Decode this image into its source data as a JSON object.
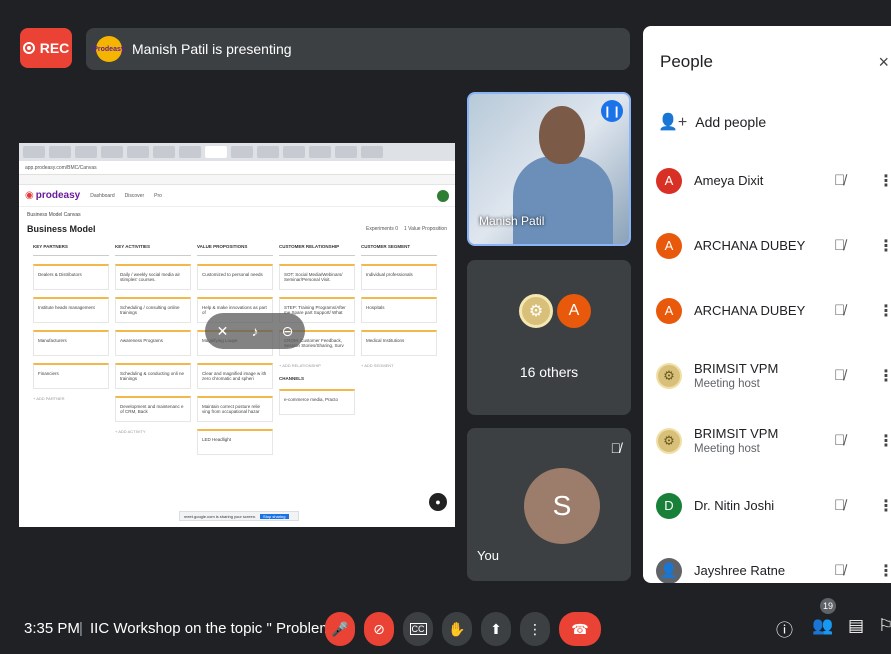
{
  "top": {
    "rec_label": "REC",
    "presenter_text": "Manish Patil is presenting",
    "presenter_logo_text": "Prodeasy"
  },
  "shared_screen": {
    "brand": "prodeasy",
    "nav": [
      "Dashboard",
      "Discover",
      "Pro"
    ],
    "address": "app.prodeasy.com/BMC/Canvas",
    "breadcrumb": "Business Model Canvas",
    "board_title": "Business Model",
    "board_actions": [
      "Experiments 0",
      "1 Value Proposition"
    ],
    "columns": [
      {
        "header": "KEY PARTNERS",
        "cards": [
          "Dealers & Distributors",
          "Institute heads management",
          "Manufacturers",
          "Financiers"
        ],
        "add": "+ ADD PARTNER"
      },
      {
        "header": "KEY ACTIVITIES",
        "cards": [
          "Daily / weekly social media air stimples' courses.",
          "Scheduling / consulting online trainings",
          "Awareness Programs",
          "Scheduling & conducting onli ne trainings",
          "Development and maintenanc e of CRM, Back"
        ],
        "add": "+ ADD ACTIVITY"
      },
      {
        "header": "VALUE PROPOSITIONS",
        "cards": [
          "Customized to personal needs",
          "Help & make innovations as part of",
          "Magnifying Loupe",
          "Clear and magnified image w ith zero chromatic and spheri",
          "Maintain correct posture relie ving from occupational hazar",
          "LED Headlight"
        ],
        "add": ""
      },
      {
        "header": "CUSTOMER RELATIONSHIP",
        "cards": [
          "SOT: Social Media/Webinars/ Seminar/Personal Visit.",
          "STEP: Training Programs/After me Spare part Support/ What",
          "CROM: Customer Feedback, Session Stories/Sharing, Surv"
        ],
        "add": "+ ADD RELATIONSHIP",
        "sub_header": "CHANNELS",
        "sub_cards": [
          "e-commerce media, Practo"
        ]
      },
      {
        "header": "CUSTOMER SEGMENT",
        "cards": [
          "Individual professionals",
          "Hospitals",
          "Medical Institutions"
        ],
        "add": "+ ADD SEGMENT"
      }
    ],
    "share_notice": "meet.google.com is sharing your screen.",
    "share_notice_button": "Stop sharing"
  },
  "tiles": {
    "camera_name": "Manish Patil",
    "others_count": "16 others",
    "others_avatar_letter": "A",
    "you_label": "You",
    "you_avatar_letter": "S"
  },
  "people_panel": {
    "title": "People",
    "close_icon": "×",
    "add_people": "Add people",
    "participants": [
      {
        "name": "Ameya Dixit",
        "role": "",
        "letter": "A",
        "color": "#d93025",
        "type": "letter"
      },
      {
        "name": "ARCHANA DUBEY",
        "role": "",
        "letter": "A",
        "color": "#e8590c",
        "type": "letter"
      },
      {
        "name": "ARCHANA DUBEY",
        "role": "",
        "letter": "A",
        "color": "#e8590c",
        "type": "letter"
      },
      {
        "name": "BRIMSIT VPM",
        "role": "Meeting host",
        "letter": "",
        "color": "#d8c07a",
        "type": "emblem"
      },
      {
        "name": "BRIMSIT VPM",
        "role": "Meeting host",
        "letter": "",
        "color": "#d8c07a",
        "type": "emblem"
      },
      {
        "name": "Dr. Nitin Joshi",
        "role": "",
        "letter": "D",
        "color": "#188038",
        "type": "letter"
      },
      {
        "name": "Jayshree Ratne",
        "role": "",
        "letter": "",
        "color": "#5f6368",
        "type": "photo"
      }
    ]
  },
  "bottom_bar": {
    "time": "3:35 PM",
    "separator": "|",
    "meeting_title": "IIC Workshop on the topic \" Problem ...",
    "cc_label": "CC",
    "people_badge": "19"
  },
  "colors": {
    "record_red": "#ea4335",
    "speaking_blue": "#1a73e8",
    "dark_bg": "#202124",
    "tile_bg": "#3c4043"
  }
}
